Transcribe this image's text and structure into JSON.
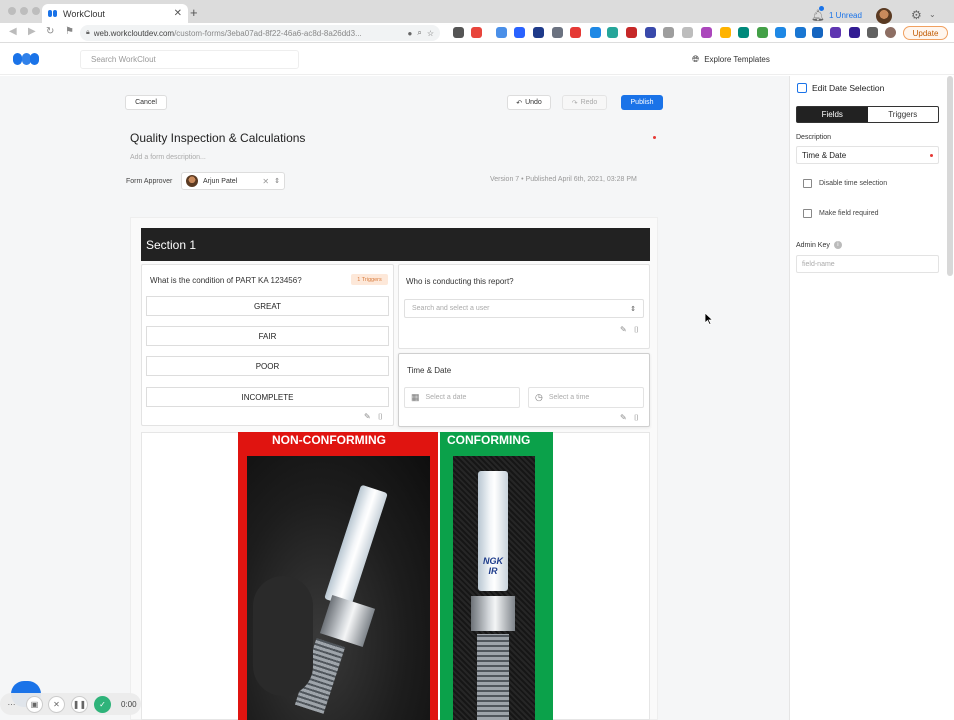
{
  "browser": {
    "tab_title": "WorkClout",
    "url_main": "web.workcloutdev.com",
    "url_path": "/custom-forms/3eba07ad-8f22-46a6-ac8d-8a26dd3...",
    "update_label": "Update"
  },
  "header": {
    "search_placeholder": "Search WorkClout",
    "explore_label": "Explore Templates",
    "unread_label": "1 Unread"
  },
  "toolbar": {
    "cancel_label": "Cancel",
    "undo_label": "Undo",
    "redo_label": "Redo",
    "publish_label": "Publish"
  },
  "form": {
    "title": "Quality Inspection & Calculations",
    "description_placeholder": "Add a form description...",
    "approver_label": "Form Approver",
    "approver_name": "Arjun Patel",
    "version_text": "Version 7 • Published April 6th, 2021, 03:28 PM",
    "section_title": "Section 1",
    "q1": {
      "text": "What is the condition of PART KA 123456?",
      "badge": "1 Triggers",
      "options": [
        "GREAT",
        "FAIR",
        "POOR",
        "INCOMPLETE"
      ]
    },
    "q2": {
      "text": "Who is conducting this report?",
      "placeholder": "Search and select a user"
    },
    "q3": {
      "text": "Time & Date",
      "date_placeholder": "Select a date",
      "time_placeholder": "Select a time"
    },
    "image_labels": {
      "left": "NON-CONFORMING",
      "right": "CONFORMING"
    },
    "plug_text": "NGK IR"
  },
  "right_panel": {
    "title": "Edit Date Selection",
    "tab_fields": "Fields",
    "tab_triggers": "Triggers",
    "description_label": "Description",
    "description_value": "Time & Date",
    "disable_time_label": "Disable time selection",
    "required_label": "Make field required",
    "admin_key_label": "Admin Key",
    "admin_key_placeholder": "field-name"
  },
  "recorder": {
    "time": "0:00"
  },
  "colors": {
    "accent": "#1a73e8",
    "nonconforming": "#e01410",
    "conforming": "#0ba14a"
  }
}
